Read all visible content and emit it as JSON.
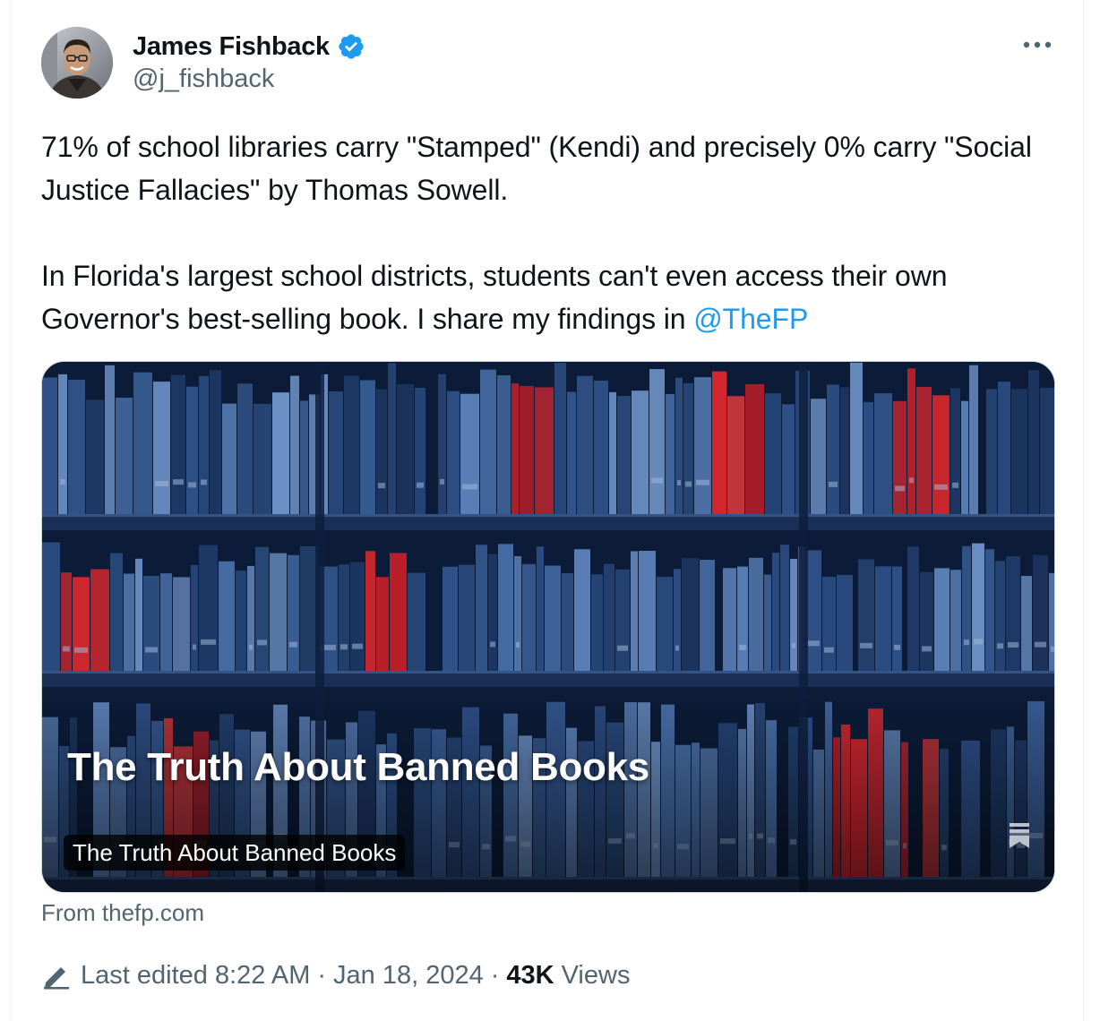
{
  "author": {
    "display_name": "James Fishback",
    "handle": "@j_fishback",
    "verified": true,
    "verified_color": "#1d9bf0"
  },
  "tweet": {
    "paragraph_1": "71% of school libraries carry \"Stamped\" (Kendi) and precisely 0% carry \"Social Justice Fallacies\" by Thomas Sowell.",
    "paragraph_2_text": "In Florida's largest school districts, students can't even access their own Governor's best-selling book. I share my findings in ",
    "mention": "@TheFP",
    "mention_color": "#1d9bf0"
  },
  "card": {
    "headline": "The Truth About Banned Books",
    "title_pill": "The Truth About Banned Books",
    "source": "From thefp.com"
  },
  "meta": {
    "edited_label": "Last edited",
    "time": "8:22 AM",
    "date": "Jan 18, 2024",
    "views_count": "43K",
    "views_label": "Views",
    "separator": "·"
  },
  "icons": {
    "more": "more-icon",
    "verified": "verified-badge-icon",
    "pencil": "pencil-icon",
    "bookmark": "bookmark-icon"
  }
}
